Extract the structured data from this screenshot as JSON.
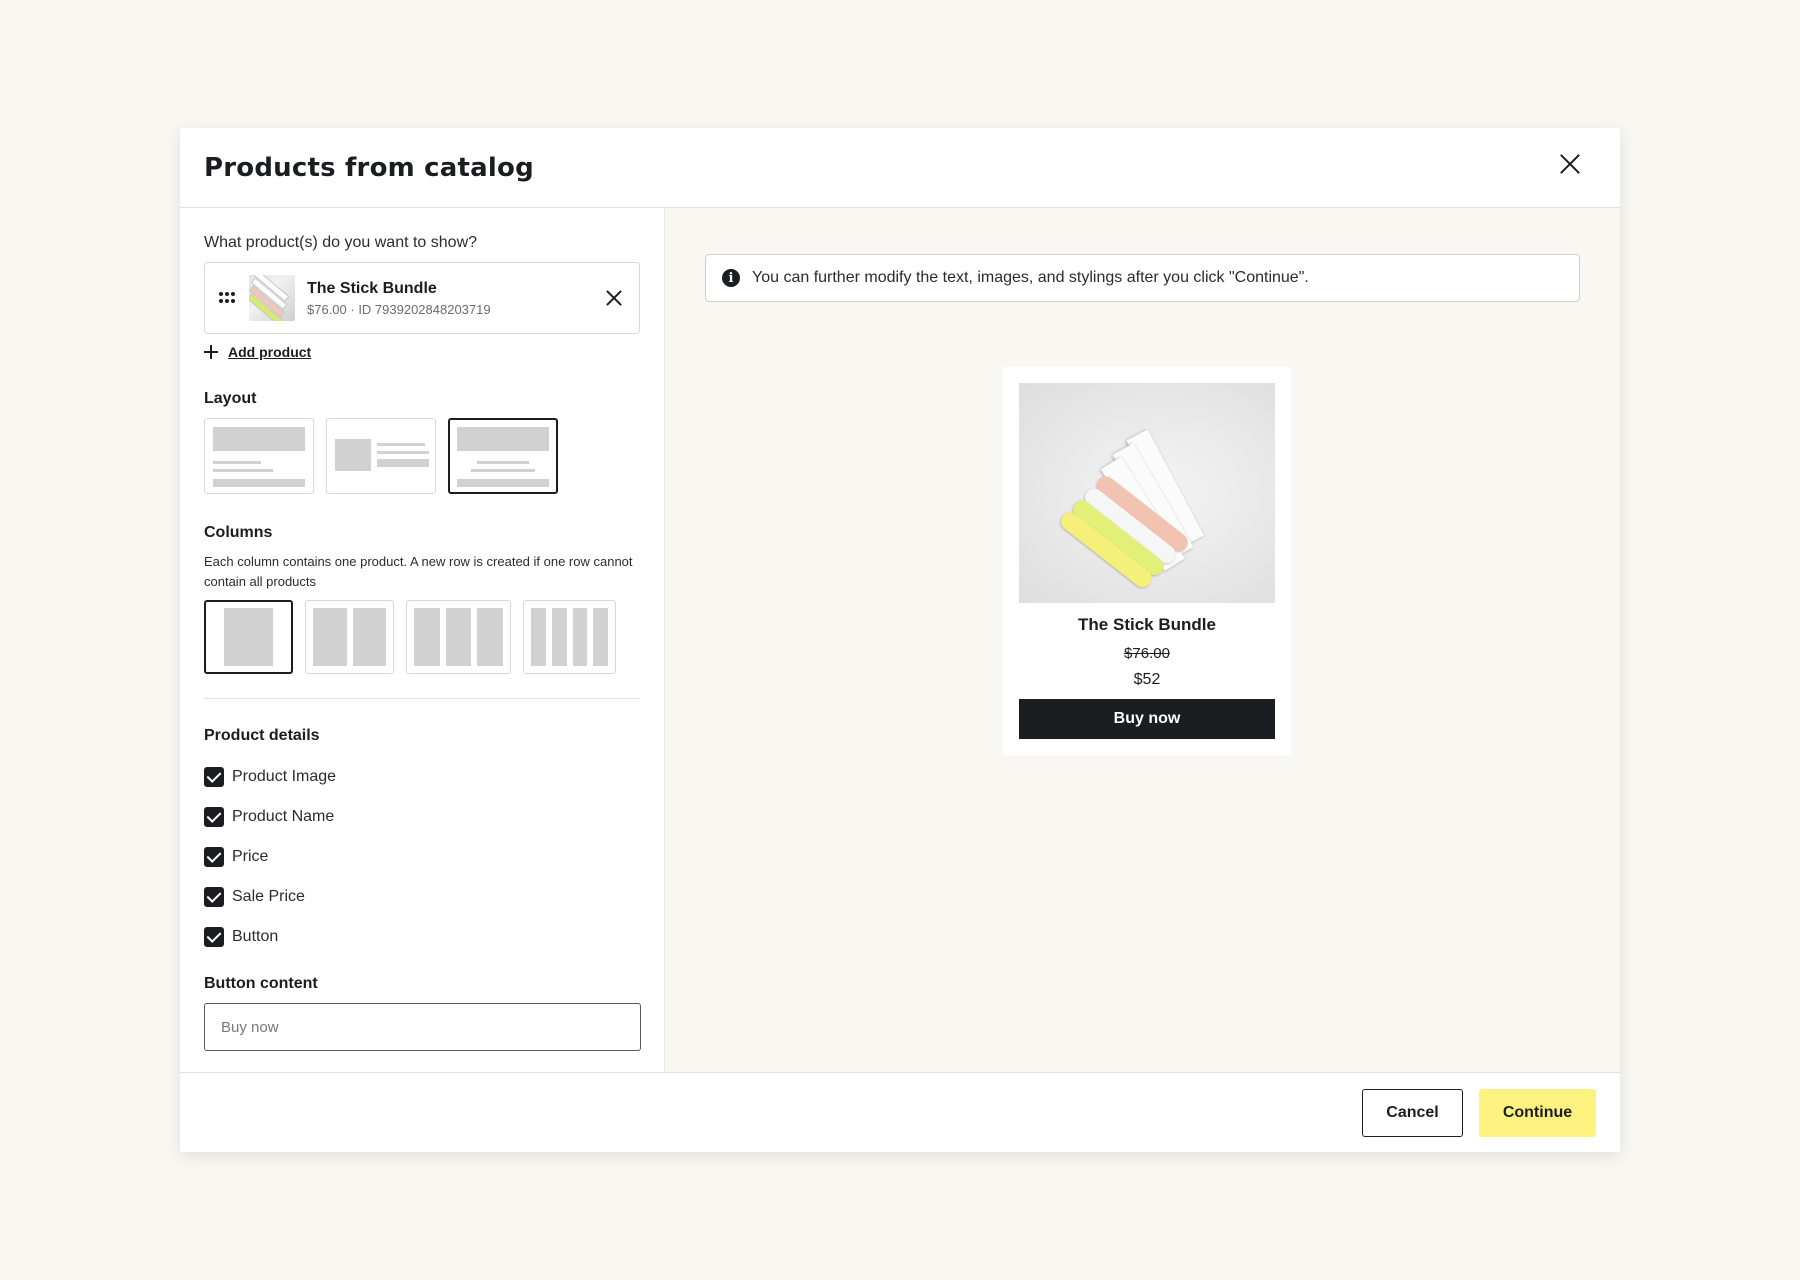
{
  "modal": {
    "title": "Products from catalog"
  },
  "left": {
    "question": "What product(s) do you want to show?",
    "product": {
      "name": "The Stick Bundle",
      "meta": "$76.00 · ID 7939202848203719"
    },
    "add_product_label": "Add product",
    "layout_title": "Layout",
    "layout_options": [
      "image-top-text-below",
      "image-left-text-right",
      "image-top-centered"
    ],
    "layout_selected_index": 2,
    "columns_title": "Columns",
    "columns_description": "Each column contains one product. A new row is created if one row cannot contain all products",
    "column_options": [
      1,
      2,
      3,
      4
    ],
    "columns_selected": 1,
    "product_details_title": "Product details",
    "product_details": [
      {
        "label": "Product Image",
        "checked": true
      },
      {
        "label": "Product Name",
        "checked": true
      },
      {
        "label": "Price",
        "checked": true
      },
      {
        "label": "Sale Price",
        "checked": true
      },
      {
        "label": "Button",
        "checked": true
      }
    ],
    "button_content_title": "Button content",
    "button_content_placeholder": "Buy now"
  },
  "preview": {
    "info_text": "You can further modify the text, images, and stylings after you click \"Continue\".",
    "product_name": "The Stick Bundle",
    "original_price": "$76.00",
    "sale_price": "$52",
    "button_label": "Buy now",
    "button_color": "#1c1d21"
  },
  "footer": {
    "cancel_label": "Cancel",
    "continue_label": "Continue",
    "continue_color": "#fdf17f"
  }
}
